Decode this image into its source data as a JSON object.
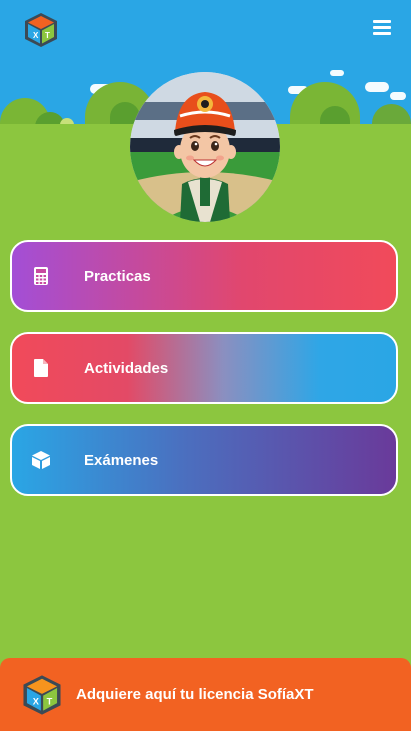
{
  "app": {
    "logo_icon": "sofiaxt-cube-logo",
    "menu_icon": "hamburger-menu-icon"
  },
  "menu": [
    {
      "label": "Practicas",
      "icon": "calculator-icon"
    },
    {
      "label": "Actividades",
      "icon": "document-icon"
    },
    {
      "label": "Exámenes",
      "icon": "cube-icon"
    }
  ],
  "footer": {
    "text": "Adquiere aquí tu licencia SofíaXT",
    "icon": "sofiaxt-cube-logo"
  },
  "colors": {
    "background": "#8cc63f",
    "sky": "#2aa6e5",
    "footer": "#f26222"
  }
}
